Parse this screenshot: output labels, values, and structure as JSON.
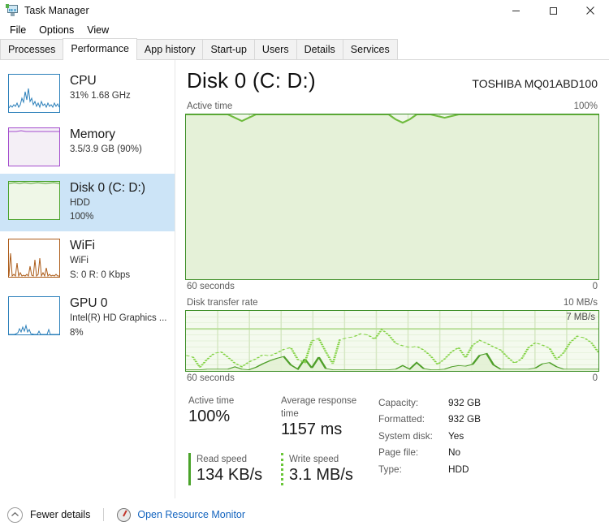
{
  "window": {
    "title": "Task Manager",
    "icon": "task-manager-icon",
    "controls": {
      "minimize": "─",
      "maximize": "□",
      "close": "✕"
    }
  },
  "menu": {
    "items": [
      "File",
      "Options",
      "View"
    ]
  },
  "tabs": {
    "items": [
      "Processes",
      "Performance",
      "App history",
      "Start-up",
      "Users",
      "Details",
      "Services"
    ],
    "active": "Performance"
  },
  "sidebar": {
    "items": [
      {
        "name": "CPU",
        "line1": "31%  1.68 GHz",
        "line2": "",
        "color": "#2a7fba",
        "fill": "#ffffff",
        "selected": false
      },
      {
        "name": "Memory",
        "line1": "3.5/3.9 GB (90%)",
        "line2": "",
        "color": "#a34bcd",
        "fill": "#f4eff6",
        "selected": false
      },
      {
        "name": "Disk 0 (C: D:)",
        "line1": "HDD",
        "line2": "100%",
        "color": "#4aa32a",
        "fill": "#eff7e7",
        "selected": true
      },
      {
        "name": "WiFi",
        "line1": "WiFi",
        "line2": "S: 0 R: 0 Kbps",
        "color": "#ac5b18",
        "fill": "#ffffff",
        "selected": false
      },
      {
        "name": "GPU 0",
        "line1": "Intel(R) HD Graphics ...",
        "line2": "8%",
        "color": "#2a7fba",
        "fill": "#ffffff",
        "selected": false
      }
    ]
  },
  "main": {
    "title": "Disk 0 (C: D:)",
    "model": "TOSHIBA MQ01ABD100",
    "active_graph": {
      "label": "Active time",
      "max_label": "100%",
      "x_left": "60 seconds",
      "x_right": "0"
    },
    "transfer_graph": {
      "label": "Disk transfer rate",
      "max_label": "10 MB/s",
      "peak_label": "7 MB/s",
      "x_left": "60 seconds",
      "x_right": "0"
    }
  },
  "stats": {
    "active_time": {
      "caption": "Active time",
      "value": "100%"
    },
    "avg_response": {
      "caption": "Average response time",
      "value": "1157 ms"
    },
    "read_speed": {
      "caption": "Read speed",
      "value": "134 KB/s"
    },
    "write_speed": {
      "caption": "Write speed",
      "value": "3.1 MB/s"
    },
    "info": [
      {
        "key": "Capacity:",
        "value": "932 GB"
      },
      {
        "key": "Formatted:",
        "value": "932 GB"
      },
      {
        "key": "System disk:",
        "value": "Yes"
      },
      {
        "key": "Page file:",
        "value": "No"
      },
      {
        "key": "Type:",
        "value": "HDD"
      }
    ]
  },
  "footer": {
    "fewer_details": "Fewer details",
    "open_resource_monitor": "Open Resource Monitor"
  },
  "colors": {
    "disk_accent": "#4aa32a",
    "disk_line": "#3f8f29",
    "disk_fill": "#f0f7e9",
    "selection": "#cce4f7",
    "link": "#1364bf"
  },
  "chart_data": [
    {
      "type": "area",
      "title": "Active time",
      "ylabel": "%",
      "xlabel": "seconds",
      "ylim": [
        0,
        100
      ],
      "xlim": [
        60,
        0
      ],
      "grid": true,
      "series": [
        {
          "name": "Active time",
          "values": [
            100,
            100,
            100,
            100,
            100,
            100,
            100,
            98,
            96,
            98,
            100,
            100,
            100,
            100,
            100,
            100,
            100,
            100,
            100,
            100,
            100,
            100,
            100,
            100,
            100,
            100,
            100,
            100,
            100,
            100,
            97,
            95,
            97,
            100,
            100,
            100,
            99,
            98,
            99,
            100,
            100,
            100,
            100,
            100,
            100,
            100,
            100,
            100,
            100,
            100,
            100,
            100,
            100,
            100,
            100,
            100,
            100,
            100,
            100,
            100
          ]
        }
      ]
    },
    {
      "type": "line",
      "title": "Disk transfer rate",
      "ylabel": "MB/s",
      "xlabel": "seconds",
      "ylim": [
        0,
        10
      ],
      "xlim": [
        60,
        0
      ],
      "grid": true,
      "peak_line": 7,
      "series": [
        {
          "name": "Read (dotted)",
          "values": [
            2.6,
            2.3,
            0.6,
            1.9,
            2.9,
            3.2,
            2.3,
            1.3,
            0.7,
            1.5,
            2.0,
            2.7,
            2.5,
            3.0,
            3.6,
            3.9,
            1.9,
            1.4,
            5.0,
            5.4,
            3.2,
            1.2,
            5.2,
            5.5,
            5.7,
            6.2,
            6.0,
            5.3,
            6.9,
            6.0,
            4.6,
            4.2,
            3.9,
            4.1,
            3.5,
            2.5,
            1.1,
            2.0,
            3.2,
            3.9,
            2.2,
            4.3,
            5.1,
            4.6,
            4.0,
            3.5,
            2.3,
            1.3,
            2.0,
            3.9,
            4.7,
            4.3,
            3.8,
            1.9,
            3.0,
            4.8,
            5.8,
            5.5,
            4.7,
            3.1
          ]
        },
        {
          "name": "Write (solid)",
          "values": [
            0.2,
            0.2,
            0.2,
            0.3,
            0.3,
            0.3,
            0.3,
            0.7,
            0.3,
            0.2,
            0.6,
            1.2,
            1.7,
            2.1,
            2.4,
            1.0,
            0.3,
            2.0,
            0.5,
            2.3,
            0.4,
            0.2,
            0.2,
            0.2,
            0.2,
            0.2,
            0.2,
            0.2,
            0.2,
            0.2,
            0.3,
            0.9,
            0.3,
            1.4,
            0.4,
            0.2,
            0.2,
            0.3,
            0.7,
            0.9,
            0.8,
            1.1,
            2.6,
            2.9,
            1.0,
            0.3,
            0.3,
            0.3,
            0.3,
            0.3,
            0.5,
            1.2,
            1.4,
            0.7,
            0.3,
            0.3,
            0.3,
            0.3,
            0.3,
            0.3
          ]
        }
      ]
    }
  ]
}
